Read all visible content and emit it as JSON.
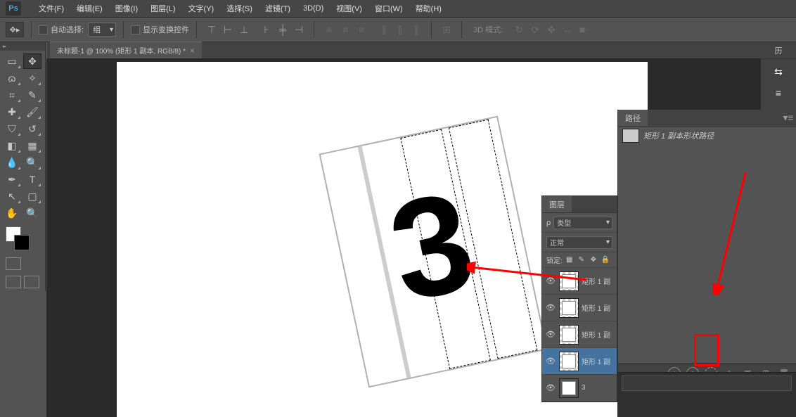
{
  "menubar": {
    "logo": "Ps",
    "items": [
      "文件(F)",
      "编辑(E)",
      "图像(I)",
      "图层(L)",
      "文字(Y)",
      "选择(S)",
      "滤镜(T)",
      "3D(D)",
      "视图(V)",
      "窗口(W)",
      "帮助(H)"
    ]
  },
  "options": {
    "auto_select_label": "自动选择:",
    "group_label": "组",
    "show_transform_label": "显示变换控件",
    "mode_3d_label": "3D 模式:"
  },
  "document": {
    "tab_title": "未标题-1 @ 100% (矩形 1 副本, RGB/8) *"
  },
  "right_tab": {
    "label": "历"
  },
  "layers_panel": {
    "title": "图层",
    "filter_icon": "ρ",
    "filter_label": "类型",
    "blend_mode": "正常",
    "lock_label": "锁定:",
    "layers": [
      {
        "name": "矩形 1 副",
        "selected": false,
        "type": "shape"
      },
      {
        "name": "矩形 1 副",
        "selected": false,
        "type": "shape"
      },
      {
        "name": "矩形 1 副",
        "selected": false,
        "type": "shape"
      },
      {
        "name": "矩形 1 副",
        "selected": true,
        "type": "shape"
      },
      {
        "name": "3",
        "selected": false,
        "type": "text"
      }
    ]
  },
  "paths_panel": {
    "title": "路径",
    "path_name": "矩形 1 副本形状路径"
  },
  "canvas": {
    "big_number": "3"
  }
}
